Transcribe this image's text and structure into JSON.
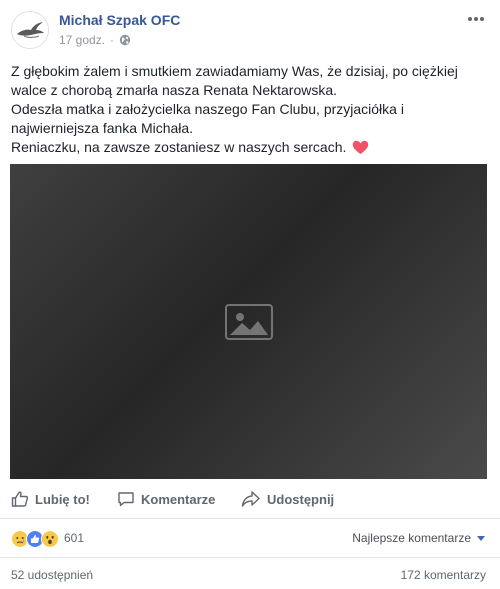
{
  "post": {
    "page_name": "Michał Szpak OFC",
    "time": "17 godz.",
    "separator": "·",
    "privacy_icon": "globe-icon",
    "menu_icon": "more-dots-icon",
    "text_lines": [
      "Z głębokim żalem i smutkiem zawiadamiamy Was, że dzisiaj, po ciężkiej walce z chorobą zmarła nasza Renata Nektarowska.",
      "Odeszła matka i założycielka naszego Fan Clubu, przyjaciółka i najwierniejsza fanka Michała.",
      "Reniaczku, na zawsze zostaniesz w naszych sercach."
    ],
    "emoji": "heart-emoji"
  },
  "actions": {
    "like_label": "Lubię to!",
    "comment_label": "Komentarze",
    "share_label": "Udostępnij"
  },
  "reactions": {
    "types": [
      "sad",
      "like",
      "wow"
    ],
    "count": "601",
    "sort_label": "Najlepsze komentarze"
  },
  "stats": {
    "shares": "52 udostępnień",
    "comments": "172 komentarzy"
  },
  "colors": {
    "link_blue": "#365899",
    "accent_blue": "#4267b2",
    "muted_gray": "#90949c",
    "action_gray": "#606770",
    "heart_pink": "#f25268"
  }
}
